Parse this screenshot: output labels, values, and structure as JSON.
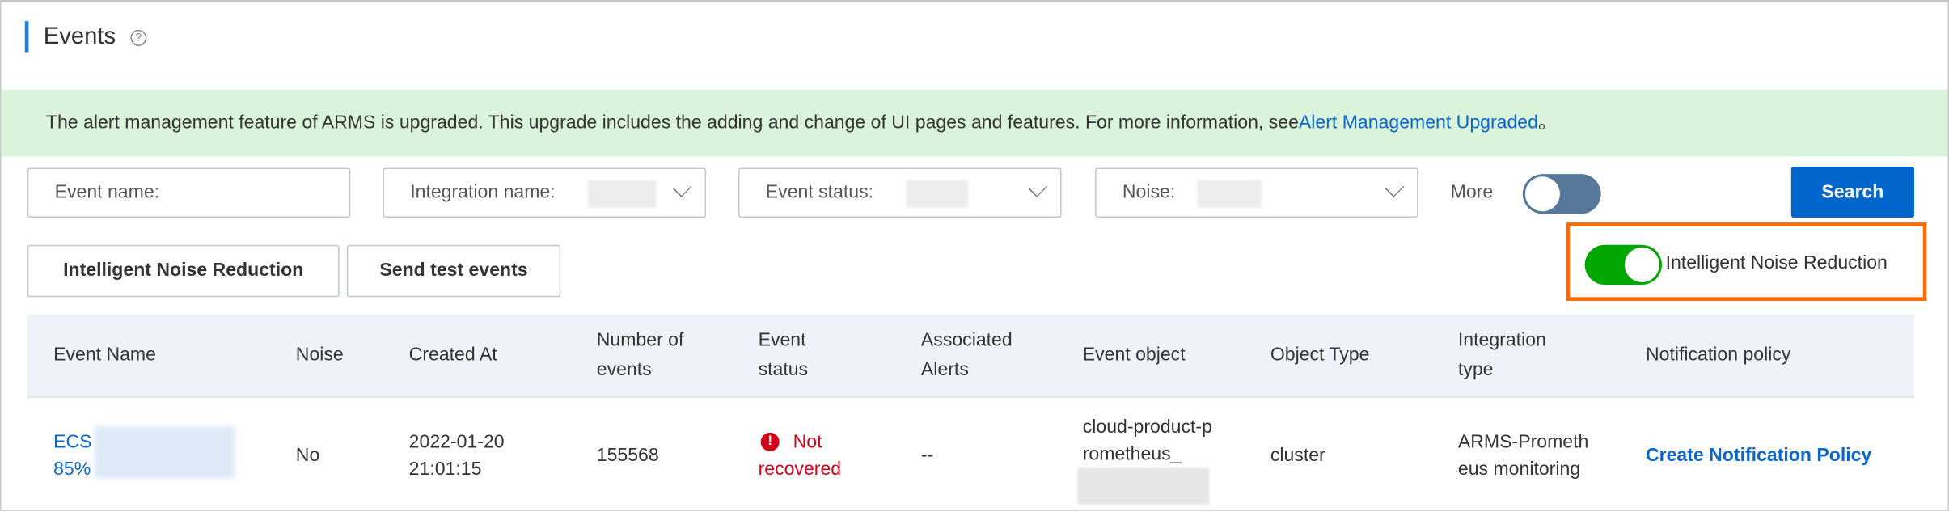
{
  "page": {
    "title": "Events",
    "help_icon": "question-circle-icon"
  },
  "banner": {
    "text": "The alert management feature of ARMS is upgraded. This upgrade includes the adding and change of UI pages and features. For more information, see",
    "link": "Alert Management Upgraded",
    "suffix": "。"
  },
  "filters": {
    "event_name": "Event name:",
    "integration_name": "Integration name:",
    "event_status": "Event status:",
    "noise": "Noise:",
    "more": "More",
    "more_toggle_on": false,
    "search": "Search"
  },
  "actions": {
    "noise_reduction": "Intelligent Noise Reduction",
    "send_test": "Send test events"
  },
  "noise_toggle": {
    "label": "Intelligent Noise Reduction",
    "on": true,
    "color": "#00a700"
  },
  "table": {
    "headers": [
      "Event Name",
      "Noise",
      "Created At",
      "Number of events",
      "Event status",
      "Associated Alerts",
      "Event object",
      "Object Type",
      "Integration type",
      "Notification policy"
    ],
    "rows": [
      {
        "event_name_a": "ECS",
        "event_name_b": "85%",
        "noise": "No",
        "created_at": "2022-01-20 21:01:15",
        "count": "155568",
        "status": "Not recovered",
        "alerts": "--",
        "object": "cloud-product-prometheus_",
        "object_type": "cluster",
        "integration": "ARMS-Prometheus monitoring",
        "policy": "Create Notification Policy"
      }
    ]
  }
}
